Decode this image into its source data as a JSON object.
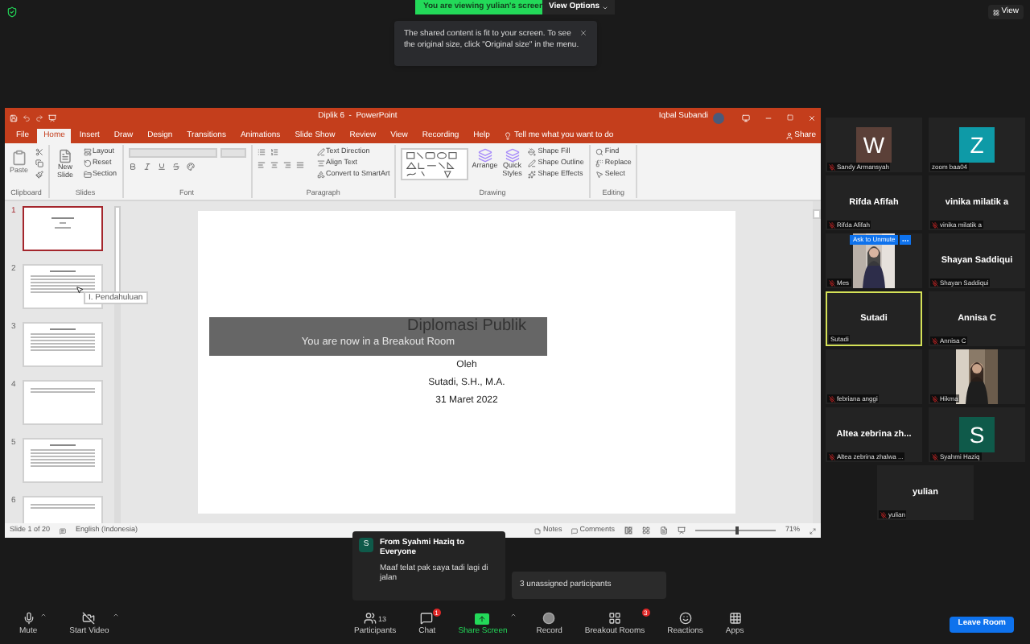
{
  "top_bar": {
    "banner": "You are viewing yulian's screen",
    "view_options": "View Options",
    "view": "View"
  },
  "notice": {
    "text": "The shared content is fit to your screen. To see the original size, click \"Original size\" in the menu."
  },
  "powerpoint": {
    "title": "Diplik 6  -  PowerPoint",
    "user": "Iqbal Subandi",
    "tabs": [
      {
        "label": "File",
        "selected": false
      },
      {
        "label": "Home",
        "selected": true
      },
      {
        "label": "Insert",
        "selected": false
      },
      {
        "label": "Draw",
        "selected": false
      },
      {
        "label": "Design",
        "selected": false
      },
      {
        "label": "Transitions",
        "selected": false
      },
      {
        "label": "Animations",
        "selected": false
      },
      {
        "label": "Slide Show",
        "selected": false
      },
      {
        "label": "Review",
        "selected": false
      },
      {
        "label": "View",
        "selected": false
      },
      {
        "label": "Recording",
        "selected": false
      },
      {
        "label": "Help",
        "selected": false
      }
    ],
    "tell_me": "Tell me what you want to do",
    "share": "Share",
    "ribbon_groups": [
      {
        "kind": "clipboard",
        "label": "Clipboard",
        "commands": [
          "Paste"
        ]
      },
      {
        "kind": "slides",
        "label": "Slides",
        "commands": [
          "New Slide",
          "Layout",
          "Reset",
          "Section"
        ]
      },
      {
        "kind": "font",
        "label": "Font"
      },
      {
        "kind": "paragraph",
        "label": "Paragraph",
        "commands": [
          "Text Direction",
          "Align Text",
          "Convert to SmartArt"
        ]
      },
      {
        "kind": "drawing",
        "label": "Drawing",
        "commands": [
          "Arrange",
          "Quick Styles",
          "Shape Fill",
          "Shape Outline",
          "Shape Effects"
        ]
      },
      {
        "kind": "editing",
        "label": "Editing",
        "commands": [
          "Find",
          "Replace",
          "Select"
        ]
      }
    ],
    "slides": [
      {
        "number": "1",
        "selected": true,
        "kind": "title"
      },
      {
        "number": "2",
        "selected": false,
        "kind": "text",
        "tooltip": "I. Pendahuluan"
      },
      {
        "number": "3",
        "selected": false,
        "kind": "text"
      },
      {
        "number": "4",
        "selected": false,
        "kind": "short"
      },
      {
        "number": "5",
        "selected": false,
        "kind": "text"
      },
      {
        "number": "6",
        "selected": false,
        "kind": "short"
      }
    ],
    "slide": {
      "title": "Diplomasi Publik",
      "lines": [
        "Oleh",
        "Sutadi, S.H., M.A.",
        "31 Maret 2022"
      ]
    },
    "breakout_notice": "You are now in a Breakout Room",
    "status_bar": {
      "slide": "Slide 1 of 20",
      "language": "English (Indonesia)",
      "notes": "Notes",
      "comments": "Comments",
      "zoom": "71%",
      "level": 0.5
    }
  },
  "participants": [
    {
      "name": "Sandy Armansyah",
      "kind": "avatar",
      "letter": "W",
      "color": "#5b4038",
      "muted": true,
      "speaking": false
    },
    {
      "name": "zoom baa04",
      "kind": "avatar",
      "letter": "Z",
      "color": "#0e9aa7",
      "muted": false,
      "speaking": false
    },
    {
      "name": "Rifda Afifah",
      "kind": "name",
      "display": "Rifda Afifah",
      "muted": true,
      "speaking": false
    },
    {
      "name": "vinika milatik a",
      "kind": "name",
      "display": "vinika milatik a",
      "muted": true,
      "speaking": false
    },
    {
      "name": "Mes",
      "kind": "video",
      "muted": true,
      "speaking": false,
      "ask_unmute": "Ask to Unmute"
    },
    {
      "name": "Shayan Saddiqui",
      "kind": "name",
      "display": "Shayan Saddiqui",
      "muted": true,
      "speaking": false
    },
    {
      "name": "Sutadi",
      "kind": "name",
      "display": "Sutadi",
      "muted": false,
      "speaking": true
    },
    {
      "name": "Annisa C",
      "kind": "name",
      "display": "Annisa C",
      "muted": true,
      "speaking": false
    },
    {
      "name": "febriana anggi",
      "kind": "blank",
      "muted": true,
      "speaking": false
    },
    {
      "name": "Hikma",
      "kind": "video",
      "muted": true,
      "speaking": false
    },
    {
      "name": "Altea zebrina zhalwa ...",
      "kind": "name",
      "display": "Altea zebrina zh...",
      "muted": true,
      "speaking": false
    },
    {
      "name": "Syahmi Haziq",
      "kind": "avatar",
      "letter": "S",
      "color": "#0f5a4a",
      "muted": true,
      "speaking": false
    },
    {
      "name": "yulian",
      "kind": "name",
      "display": "yulian",
      "muted": true,
      "speaking": false
    }
  ],
  "chat_popup": {
    "avatar": "S",
    "from": "From Syahmi Haziq to Everyone",
    "message": "Maaf telat pak saya tadi lagi di jalan"
  },
  "unassigned": "3 unassigned participants",
  "toolbar": [
    {
      "kind": "mute",
      "label": "Mute",
      "caret": true
    },
    {
      "kind": "video",
      "label": "Start Video",
      "caret": true
    },
    {
      "kind": "participants",
      "label": "Participants",
      "count": "13"
    },
    {
      "kind": "chat",
      "label": "Chat",
      "badge": "1"
    },
    {
      "kind": "share",
      "label": "Share Screen",
      "caret": true
    },
    {
      "kind": "record",
      "label": "Record"
    },
    {
      "kind": "breakout",
      "label": "Breakout Rooms",
      "badge": "3"
    },
    {
      "kind": "reactions",
      "label": "Reactions"
    },
    {
      "kind": "apps",
      "label": "Apps"
    }
  ],
  "leave": "Leave Room"
}
